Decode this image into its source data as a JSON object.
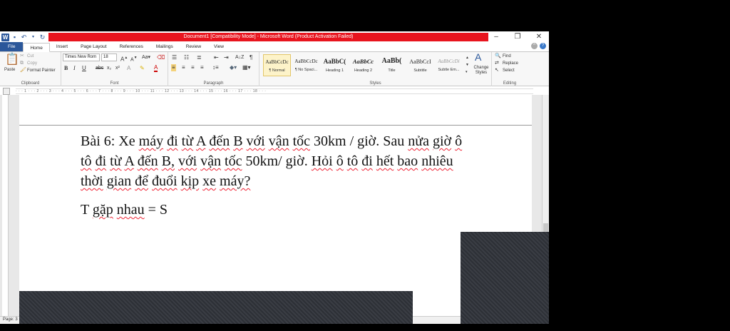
{
  "window": {
    "title": "Document1 [Compatibility Mode] - Microsoft Word (Product Activation Failed)"
  },
  "tabs": [
    {
      "label": "File"
    },
    {
      "label": "Home"
    },
    {
      "label": "Insert"
    },
    {
      "label": "Page Layout"
    },
    {
      "label": "References"
    },
    {
      "label": "Mailings"
    },
    {
      "label": "Review"
    },
    {
      "label": "View"
    }
  ],
  "ribbon": {
    "clipboard": {
      "label": "Clipboard",
      "paste": "Paste",
      "cut": "Cut",
      "copy": "Copy",
      "format_painter": "Format Painter"
    },
    "font": {
      "label": "Font",
      "name": "Times New Rom",
      "size": "18"
    },
    "paragraph": {
      "label": "Paragraph"
    },
    "styles": {
      "label": "Styles",
      "items": [
        {
          "sample": "AaBbCcDc",
          "name": "¶ Normal"
        },
        {
          "sample": "AaBbCcDc",
          "name": "¶ No Spaci..."
        },
        {
          "sample": "AaBbC(",
          "name": "Heading 1"
        },
        {
          "sample": "AaBbCc",
          "name": "Heading 2"
        },
        {
          "sample": "AaBb(",
          "name": "Title"
        },
        {
          "sample": "AaBbCcI",
          "name": "Subtitle"
        },
        {
          "sample": "AaBbCcDi",
          "name": "Subtle Em..."
        }
      ],
      "change_styles": "Change Styles"
    },
    "editing": {
      "label": "Editing",
      "find": "Find",
      "replace": "Replace",
      "select": "Select"
    }
  },
  "document": {
    "paragraph1": {
      "w1": "Bài 6: Xe",
      "w2": "máy",
      "w3": "đi",
      "w4": "từ",
      "w5": "A",
      "w6": "đến",
      "w7": "B",
      "w8": "với",
      "w9": "vận",
      "w10": "tốc",
      "w11": "30km / giờ. Sau",
      "w12": "nửa",
      "w13": "giờ",
      "w14": "ô",
      "w15": "tô",
      "w16": "đi",
      "w17": "từ",
      "w18": "A",
      "w19": "đến",
      "w20": "B,",
      "w21": "với",
      "w22": "vận",
      "w23": "tốc",
      "w24": "50km/ giờ.",
      "w25": "Hỏi",
      "w26": "ô",
      "w27": "tô",
      "w28": "đi",
      "w29": "hết",
      "w30": "bao",
      "w31": "nhiêu",
      "w32": "thời",
      "w33": "gian",
      "w34": "để",
      "w35": "đuổi",
      "w36": "kịp",
      "w37": "xe",
      "w38": "máy?"
    },
    "paragraph2": {
      "a": "T",
      "b": "gặp",
      "c": "nhau",
      "d": "= S"
    }
  },
  "status": {
    "page": "Page: 3"
  },
  "colors": {
    "title_strip": "#e8141e",
    "file_tab": "#2b579a"
  }
}
